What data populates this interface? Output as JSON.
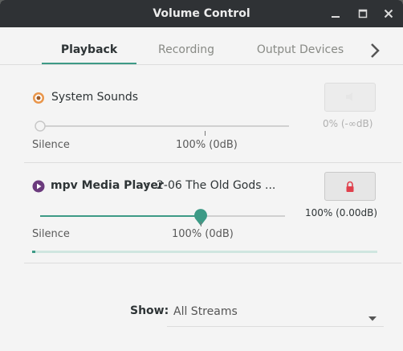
{
  "window": {
    "title": "Volume Control",
    "controls": [
      "minimize-icon",
      "maximize-icon",
      "close-icon"
    ]
  },
  "tabs": [
    {
      "label": "Playback",
      "active": true
    },
    {
      "label": "Recording",
      "active": false
    },
    {
      "label": "Output Devices",
      "active": false
    }
  ],
  "streams": [
    {
      "icon": "system-sounds-icon",
      "name": "System Sounds",
      "volume_text": "0% (-∞dB)",
      "volume_percent": 0,
      "mute_icon": "speaker-icon",
      "muted": false,
      "min_label": "Silence",
      "mark_label": "100% (0dB)"
    },
    {
      "icon": "media-player-icon",
      "app_name": "mpv Media Player",
      "separator": ":",
      "media_title": "2-06 The Old Gods ...",
      "volume_text": "100% (0.00dB)",
      "volume_percent": 100,
      "level_percent": 1,
      "mute_icon": "lock-icon",
      "min_label": "Silence",
      "mark_label": "100% (0dB)"
    }
  ],
  "filter": {
    "label": "Show:",
    "value": "All Streams"
  },
  "colors": {
    "accent": "#3d9a86",
    "titlebar": "#2f3235",
    "background": "#f4f4f4",
    "mute_red": "#e0404c"
  }
}
